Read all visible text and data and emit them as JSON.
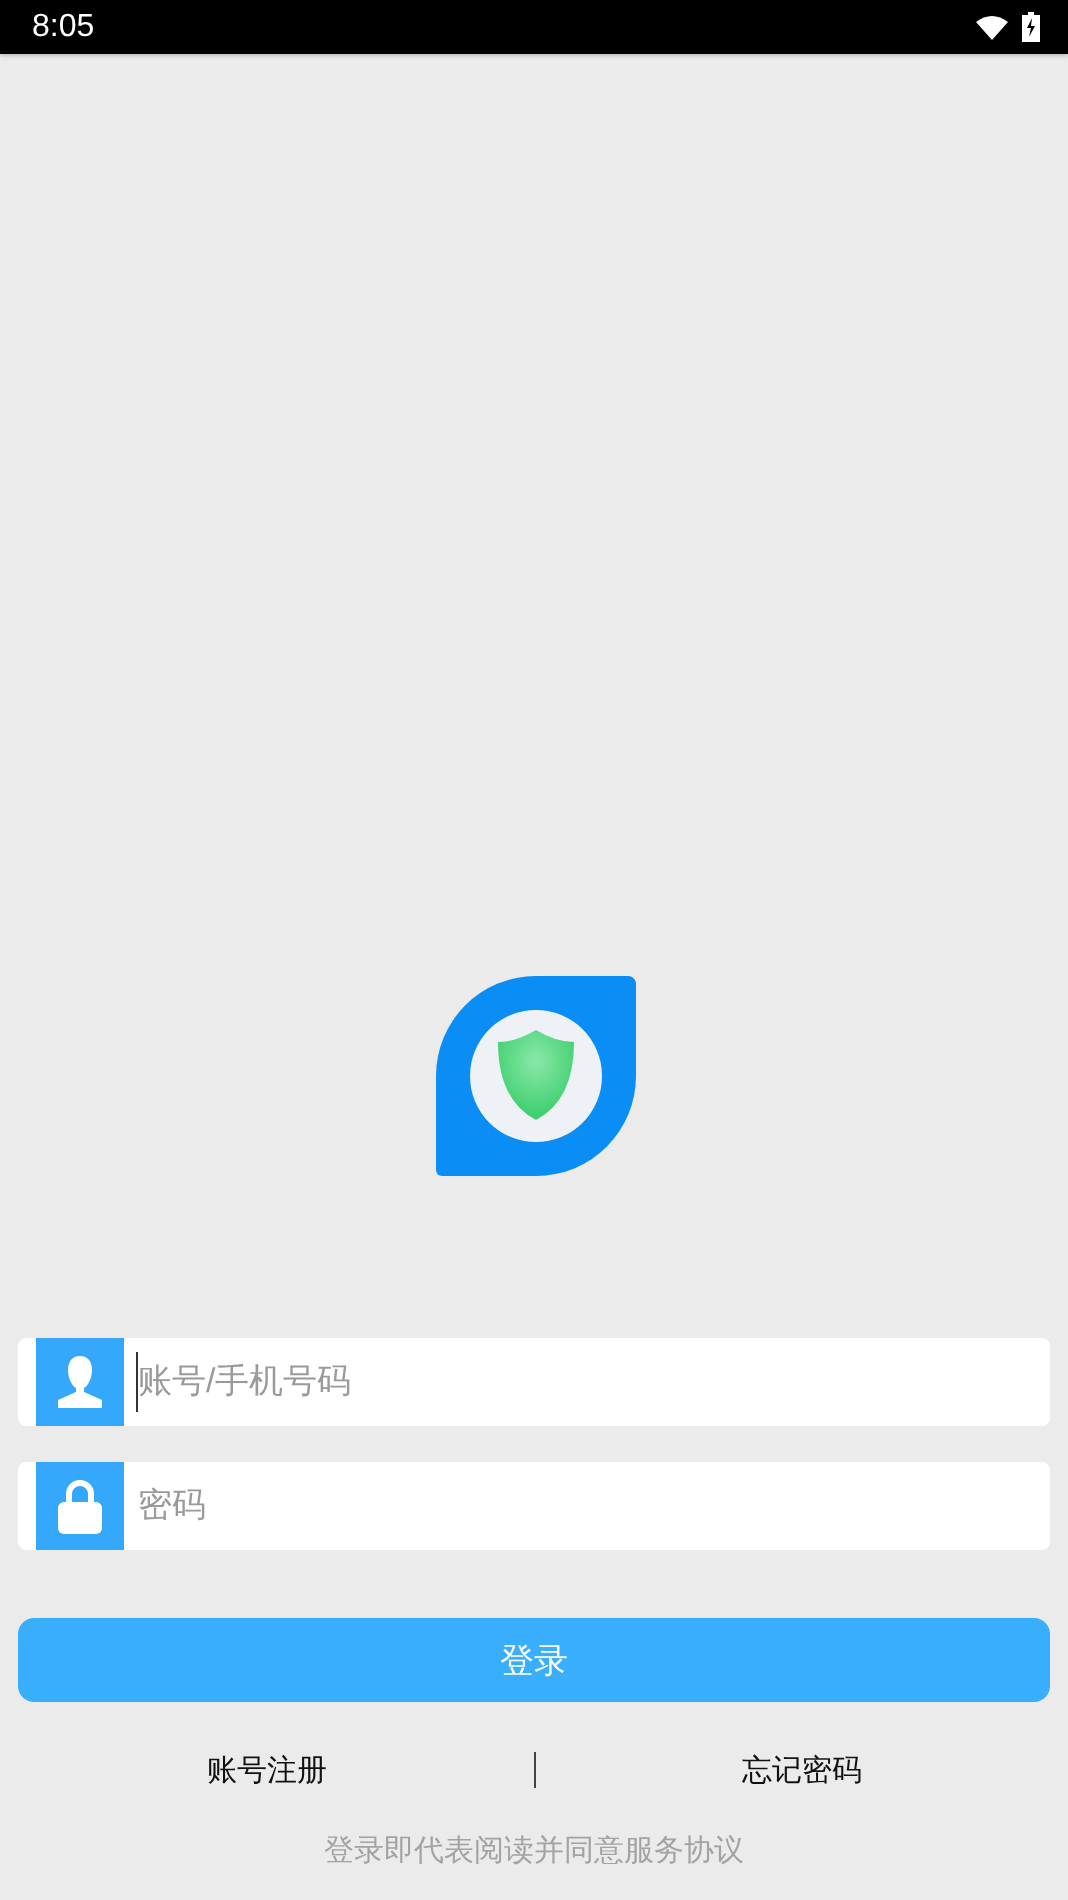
{
  "status_bar": {
    "time": "8:05"
  },
  "fields": [
    {
      "kind": "account",
      "placeholder": "账号/手机号码",
      "focused": true
    },
    {
      "kind": "password",
      "placeholder": "密码",
      "focused": false
    }
  ],
  "login_button": "登录",
  "links": [
    {
      "label": "账号注册"
    },
    {
      "label": "忘记密码"
    }
  ],
  "agreement": "登录即代表阅读并同意服务协议"
}
